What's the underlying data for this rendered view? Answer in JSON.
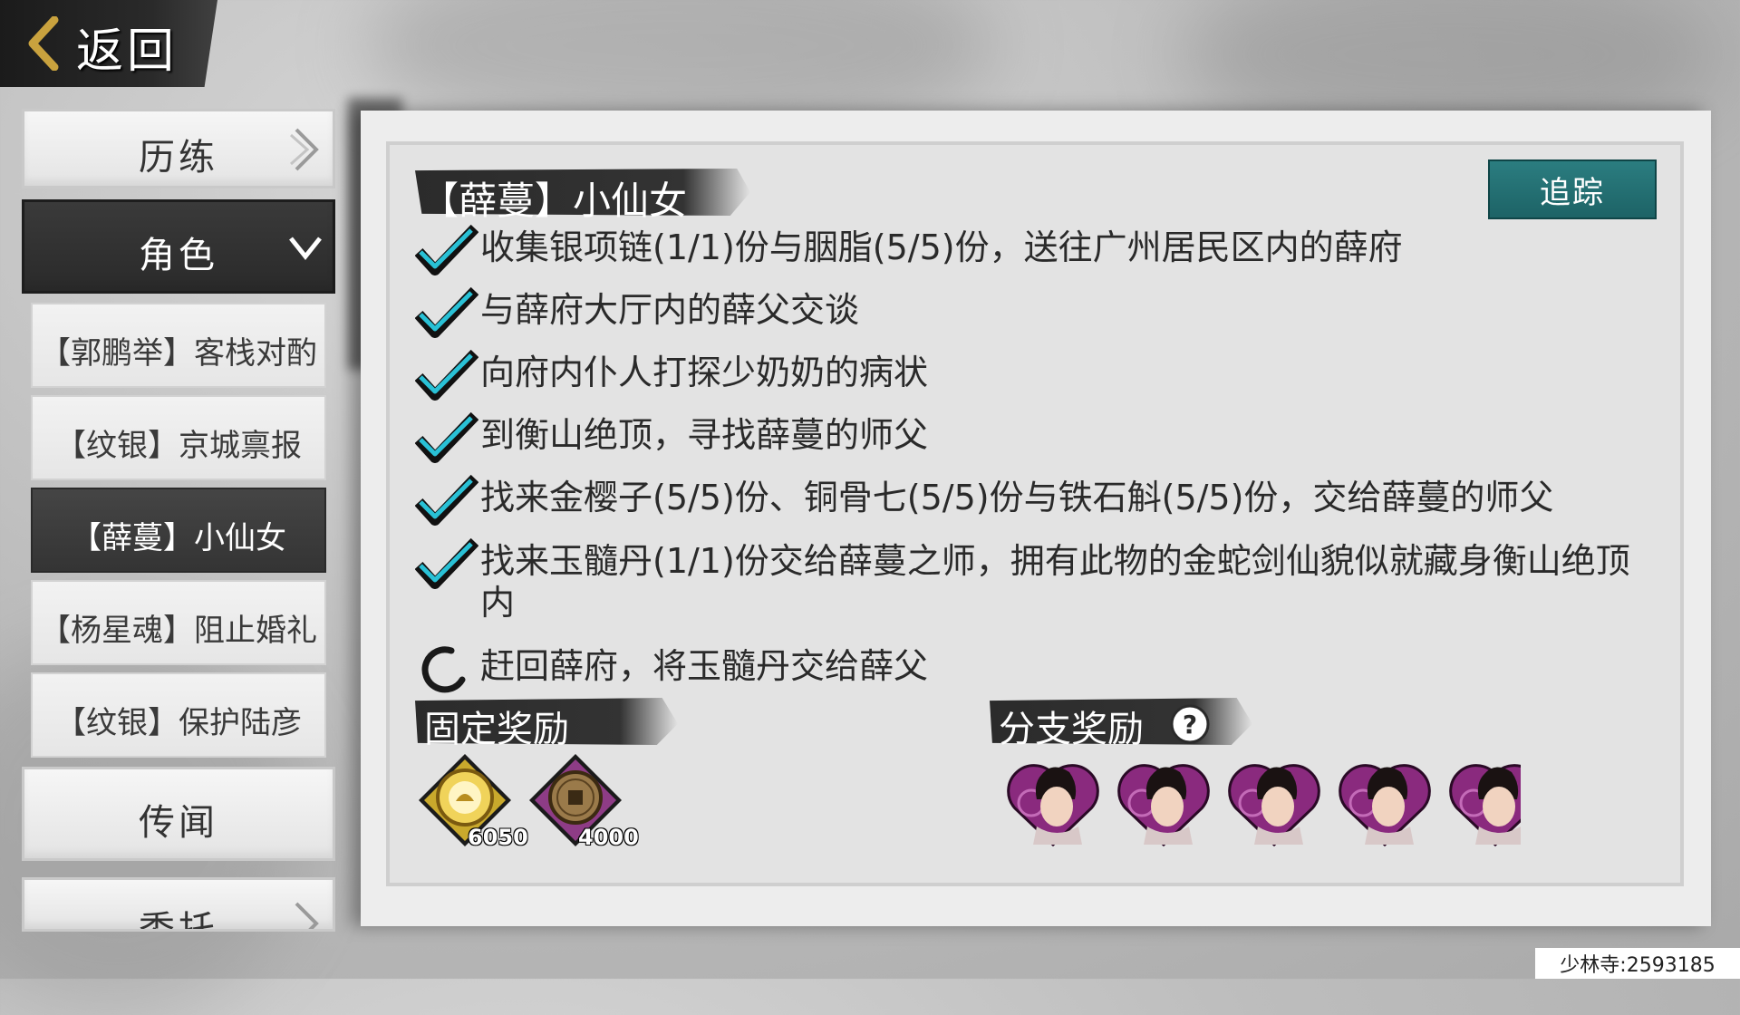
{
  "header": {
    "back_label": "返回"
  },
  "sidebar": {
    "categories": [
      {
        "label": "历练",
        "state": "collapsed"
      },
      {
        "label": "角色",
        "state": "expanded"
      },
      {
        "label": "传闻",
        "state": "collapsed"
      },
      {
        "label": "委托",
        "state": "collapsed"
      }
    ],
    "role_quests": [
      {
        "label": "【郭鹏举】客栈对酌"
      },
      {
        "label": "【纹银】京城禀报"
      },
      {
        "label": "【薛蔓】小仙女",
        "selected": true
      },
      {
        "label": "【杨星魂】阻止婚礼"
      },
      {
        "label": "【纹银】保护陆彦"
      }
    ]
  },
  "quest": {
    "title": "【薛蔓】小仙女",
    "track_label": "追踪",
    "objectives": [
      {
        "text": "收集银项链(1/1)份与胭脂(5/5)份，送往广州居民区内的薛府",
        "status": "done"
      },
      {
        "text": "与薛府大厅内的薛父交谈",
        "status": "done"
      },
      {
        "text": "向府内仆人打探少奶奶的病状",
        "status": "done"
      },
      {
        "text": "到衡山绝顶，寻找薛蔓的师父",
        "status": "done"
      },
      {
        "text": "找来金樱子(5/5)份、铜骨七(5/5)份与铁石斛(5/5)份，交给薛蔓的师父",
        "status": "done"
      },
      {
        "text": "找来玉髓丹(1/1)份交给薛蔓之师，拥有此物的金蛇剑仙貌似就藏身衡山绝顶内",
        "status": "done"
      },
      {
        "text": "赶回薛府，将玉髓丹交给薛父",
        "status": "in-progress"
      }
    ],
    "fixed_reward_label": "固定奖励",
    "branch_reward_label": "分支奖励",
    "fixed_rewards": [
      {
        "icon": "experience-icon",
        "count": "6050",
        "color": "#c9a92c"
      },
      {
        "icon": "coin-icon",
        "count": "4000",
        "color": "#8e3c86"
      }
    ],
    "branch_rewards_count": 5
  },
  "footer": {
    "server": "少林寺:2593185"
  },
  "colors": {
    "track": "#246f72",
    "check": "#1fb3c8",
    "dark_bar": "#2e2e2e"
  }
}
